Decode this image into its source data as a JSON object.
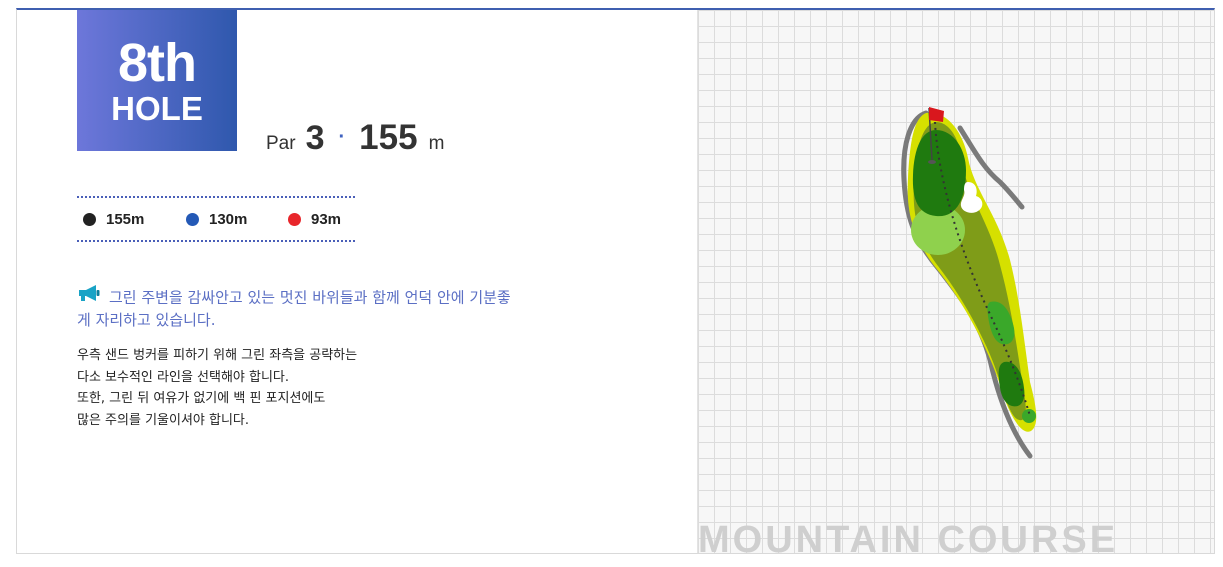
{
  "hole": {
    "number": "8th",
    "word": "HOLE",
    "par_label": "Par",
    "par_value": "3",
    "separator": "·",
    "distance_value": "155",
    "distance_unit": "m"
  },
  "tees": [
    {
      "label": "155m",
      "color": "#222222"
    },
    {
      "label": "130m",
      "color": "#2459b6"
    },
    {
      "label": "93m",
      "color": "#e8262b"
    }
  ],
  "notice": {
    "icon": "megaphone-icon",
    "text": "그린 주변을 감싸안고 있는 멋진 바위들과 함께 언덕 안에 기분좋게 자리하고 있습니다."
  },
  "description": [
    "우측 샌드 벙커를 피하기 위해 그린 좌측을 공략하는",
    "다소 보수적인 라인을 선택해야 합니다.",
    "또한, 그린 뒤 여유가 없기에 백 핀 포지션에도",
    "많은 주의를 기울이셔야 합니다."
  ],
  "map": {
    "course_name": "MOUNTAIN COURSE",
    "colors": {
      "rough": "#d6e000",
      "fairway": "#7f9c18",
      "green": "#1f7a0f",
      "tee_box": "#3aa82a",
      "bunker": "#ffffff",
      "flag": "#d9171d",
      "path": "#7a7a7a"
    }
  }
}
